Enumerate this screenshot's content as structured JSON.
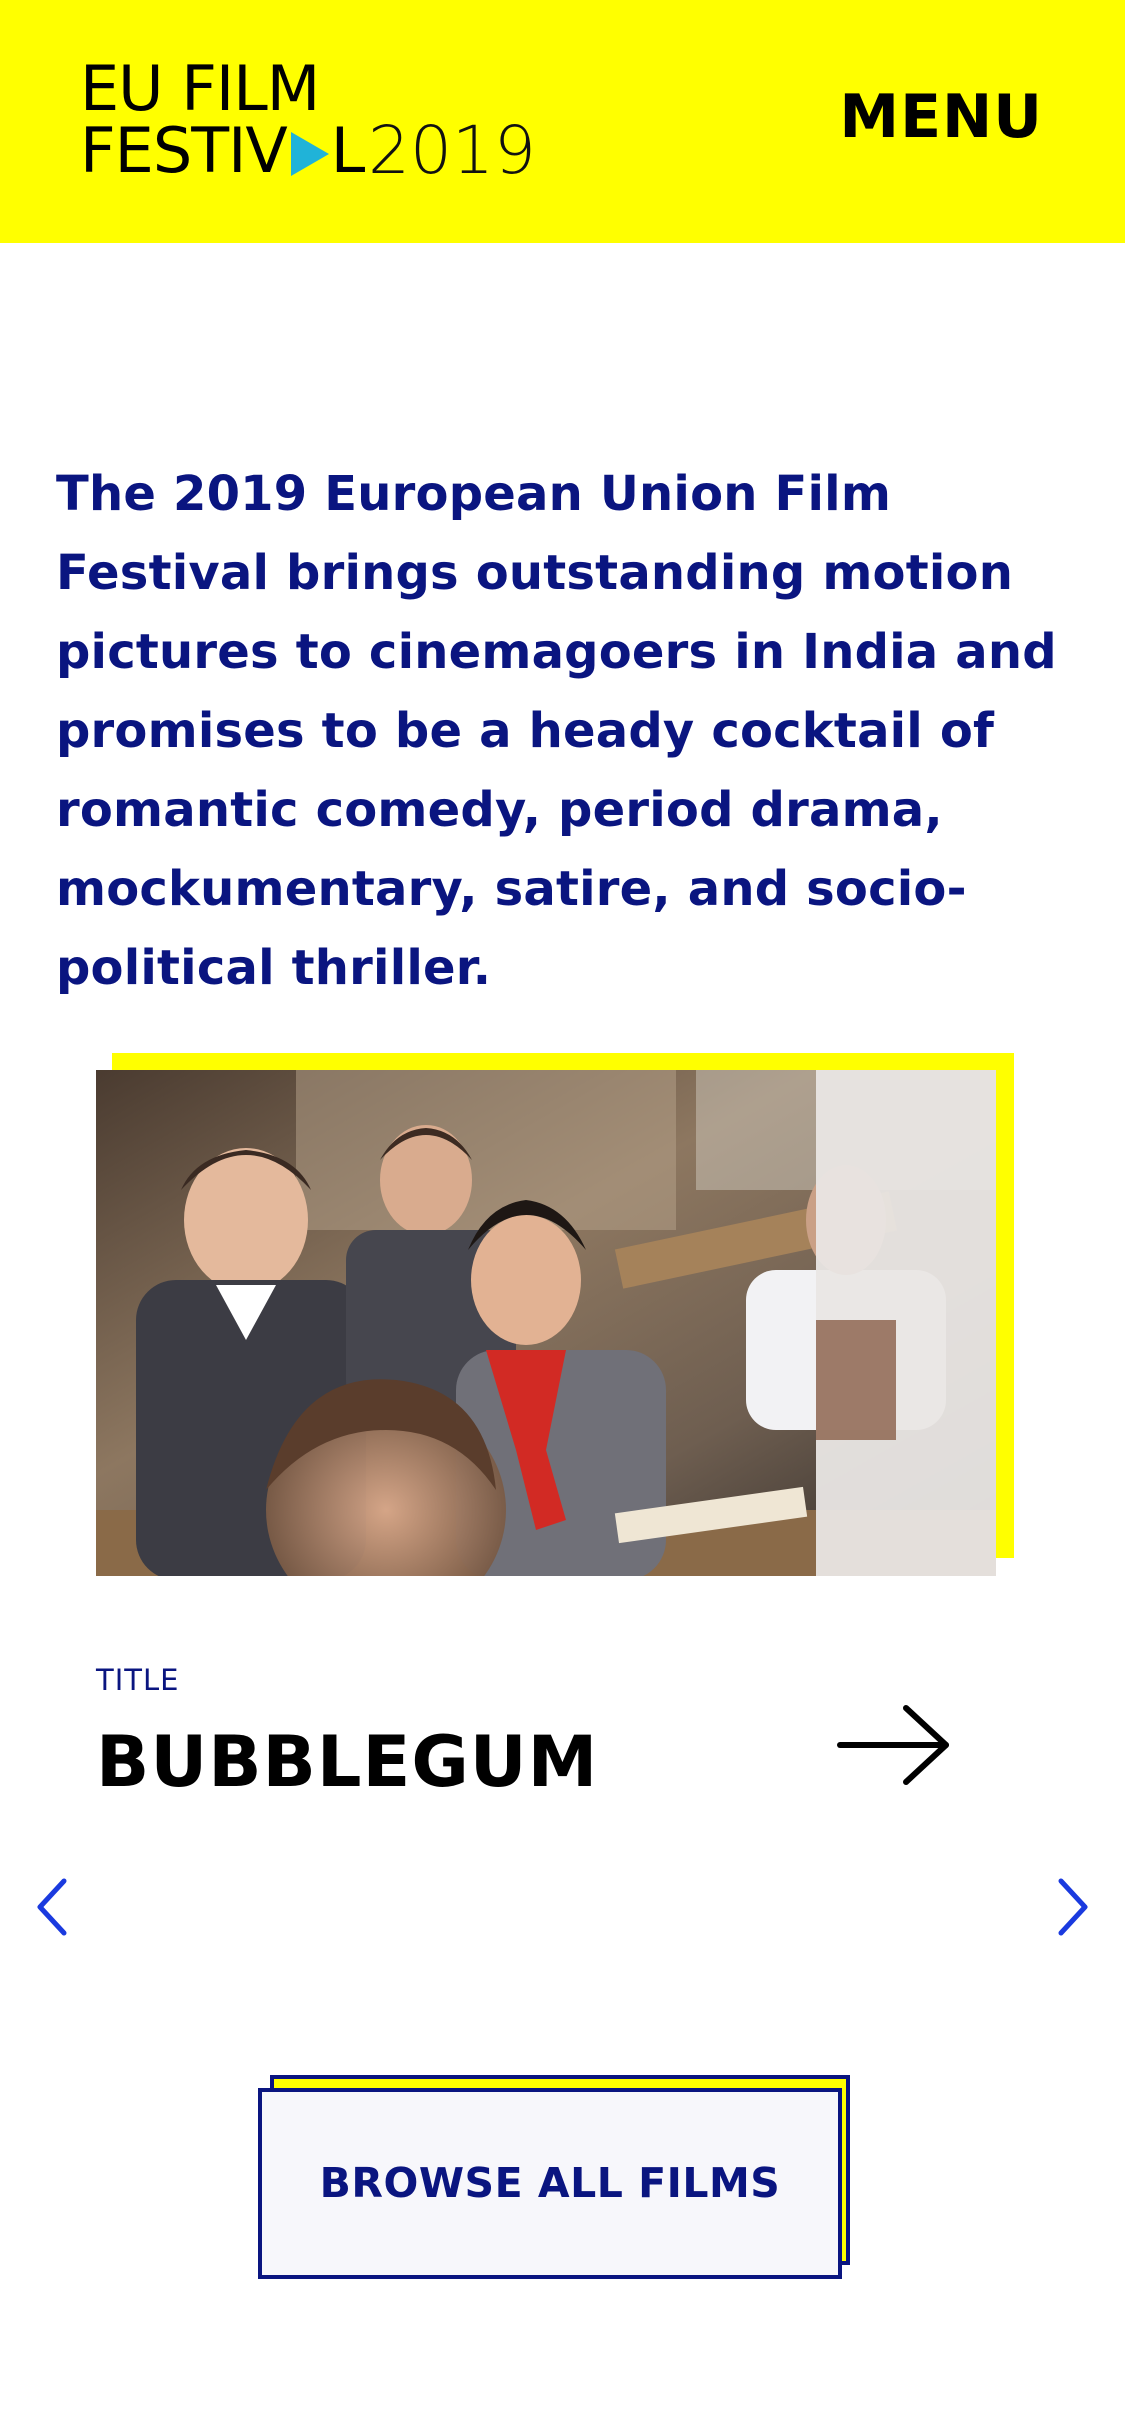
{
  "header": {
    "logo_line1": "EU FILM",
    "logo_line2_left": "FESTIV",
    "logo_line2_right": "L",
    "logo_year": "2019",
    "menu_label": "MENU"
  },
  "intro": {
    "text": "The 2019 European Union Film Festival brings outstanding motion pictures to cinemagoers in India and promises to be a heady cocktail of romantic comedy, period drama, mockumentary, satire, and socio-political thriller."
  },
  "carousel": {
    "title_label": "TITLE",
    "film_title": "BUBBLEGUM"
  },
  "browse_button": {
    "label": "BROWSE ALL FILMS"
  },
  "colors": {
    "brand_yellow": "#ffff00",
    "brand_navy": "#0a1580",
    "logo_play": "#20b3d8",
    "nav_blue": "#1a3adf"
  },
  "icons": {
    "logo_play": "play-triangle-icon",
    "title_arrow": "arrow-right-icon",
    "prev": "chevron-left-icon",
    "next": "chevron-right-icon"
  }
}
